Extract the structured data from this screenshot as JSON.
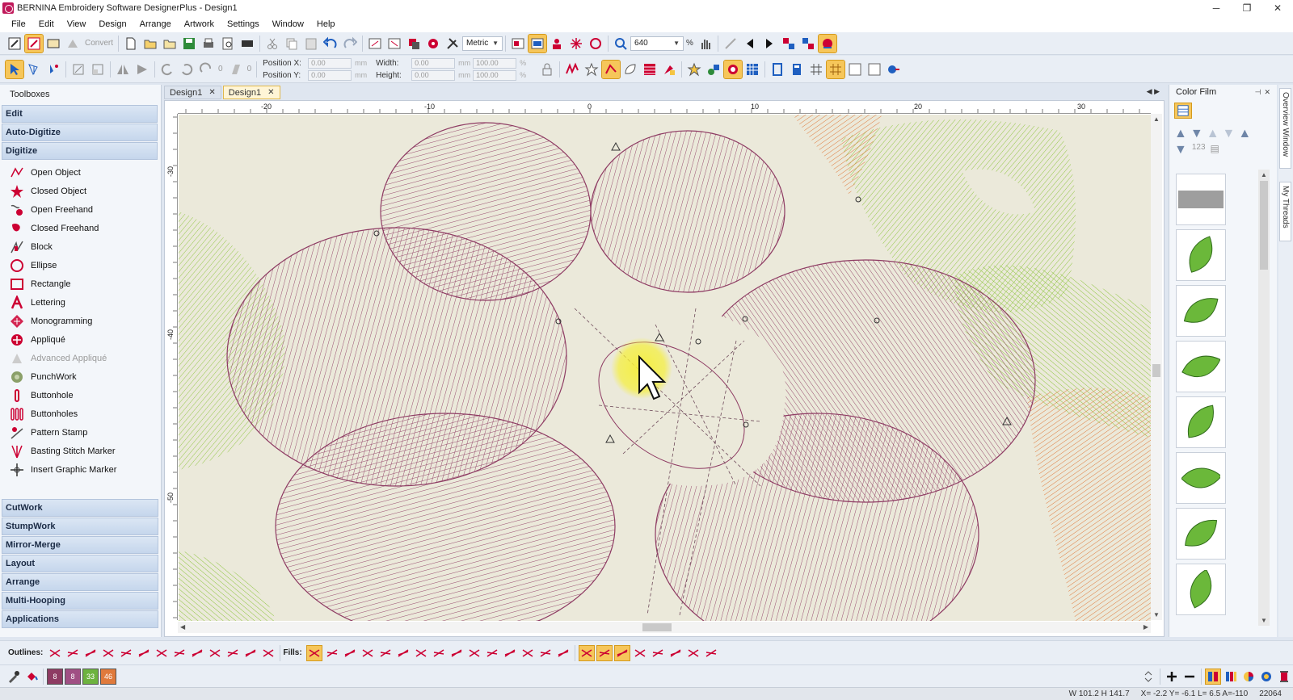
{
  "window": {
    "title": "BERNINA Embroidery Software DesignerPlus - Design1",
    "minimize": "─",
    "restore": "❐",
    "close": "✕"
  },
  "menu": [
    "File",
    "Edit",
    "View",
    "Design",
    "Arrange",
    "Artwork",
    "Settings",
    "Window",
    "Help"
  ],
  "toolbar1": {
    "convert_label": "Convert",
    "units": "Metric",
    "zoom": "640",
    "zoom_unit": "%"
  },
  "toolbar2": {
    "rotate_value": "0",
    "slant_value": "0",
    "position_x_label": "Position X:",
    "position_y_label": "Position Y:",
    "position_x": "0.00",
    "position_y": "0.00",
    "width_label": "Width:",
    "height_label": "Height:",
    "width": "0.00",
    "height": "0.00",
    "width_pct": "100.00",
    "height_pct": "100.00",
    "unit": "mm",
    "pct": "%"
  },
  "left_panel": {
    "title": "Toolboxes",
    "groups_top": [
      "Edit",
      "Auto-Digitize",
      "Digitize"
    ],
    "digitize_tools": [
      {
        "label": "Open Object",
        "icon": "open-object-icon",
        "enabled": true
      },
      {
        "label": "Closed Object",
        "icon": "closed-object-icon",
        "enabled": true
      },
      {
        "label": "Open Freehand",
        "icon": "open-freehand-icon",
        "enabled": true
      },
      {
        "label": "Closed Freehand",
        "icon": "closed-freehand-icon",
        "enabled": true
      },
      {
        "label": "Block",
        "icon": "block-icon",
        "enabled": true
      },
      {
        "label": "Ellipse",
        "icon": "ellipse-icon",
        "enabled": true
      },
      {
        "label": "Rectangle",
        "icon": "rectangle-icon",
        "enabled": true
      },
      {
        "label": "Lettering",
        "icon": "lettering-icon",
        "enabled": true
      },
      {
        "label": "Monogramming",
        "icon": "monogramming-icon",
        "enabled": true
      },
      {
        "label": "Appliqué",
        "icon": "applique-icon",
        "enabled": true
      },
      {
        "label": "Advanced Appliqué",
        "icon": "advanced-applique-icon",
        "enabled": false
      },
      {
        "label": "PunchWork",
        "icon": "punchwork-icon",
        "enabled": true
      },
      {
        "label": "Buttonhole",
        "icon": "buttonhole-icon",
        "enabled": true
      },
      {
        "label": "Buttonholes",
        "icon": "buttonholes-icon",
        "enabled": true
      },
      {
        "label": "Pattern Stamp",
        "icon": "pattern-stamp-icon",
        "enabled": true
      },
      {
        "label": "Basting Stitch Marker",
        "icon": "basting-marker-icon",
        "enabled": true
      },
      {
        "label": "Insert Graphic Marker",
        "icon": "graphic-marker-icon",
        "enabled": true
      }
    ],
    "groups_bottom": [
      "CutWork",
      "StumpWork",
      "Mirror-Merge",
      "Layout",
      "Arrange",
      "Multi-Hooping",
      "Applications"
    ]
  },
  "doc_tabs": [
    {
      "label": "Design1",
      "active": false
    },
    {
      "label": "Design1",
      "active": true
    }
  ],
  "rulers": {
    "h_ticks": [
      "-20",
      "-10",
      "0",
      "10",
      "20",
      "30"
    ],
    "v_ticks": [
      "-30",
      "-40",
      "-50"
    ]
  },
  "colors": {
    "thread_purple": "#8e3b63",
    "thread_green": "#8cc43c",
    "thread_orange": "#e07a3c",
    "fabric": "#ebe9da",
    "highlight": "#f6c65a"
  },
  "right_panel": {
    "title": "Color Film",
    "swatches": [
      "fabric-texture",
      "leaf-1",
      "leaf-2",
      "leaf-3",
      "leaf-4",
      "leaf-5",
      "leaf-6",
      "leaf-7"
    ]
  },
  "side_tabs": [
    "Overview Window",
    "My Threads"
  ],
  "bottom": {
    "outlines_label": "Outlines:",
    "fills_label": "Fills:",
    "chips": [
      {
        "label": "8",
        "color": "#8e3b63"
      },
      {
        "label": "8",
        "color": "#a04f84"
      },
      {
        "label": "33",
        "color": "#6db33f"
      },
      {
        "label": "46",
        "color": "#e07a3c"
      }
    ]
  },
  "status": {
    "size": "W 101.2 H 141.7",
    "coords": "X=  -2.2 Y=   -6.1 L=   6.5 A=-110",
    "stitches": "22064"
  }
}
